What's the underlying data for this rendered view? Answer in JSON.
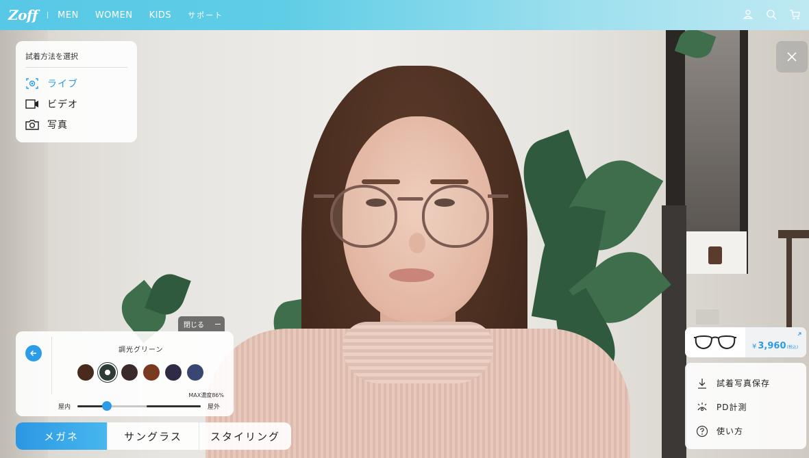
{
  "nav": {
    "logo": "Zoff",
    "links": [
      "MEN",
      "WOMEN",
      "KIDS",
      "サポート"
    ],
    "icons": [
      "user-icon",
      "search-icon",
      "cart-icon"
    ]
  },
  "mode_panel": {
    "title": "試着方法を選択",
    "items": [
      {
        "label": "ライブ",
        "icon": "live-camera-icon",
        "active": true
      },
      {
        "label": "ビデオ",
        "icon": "video-icon",
        "active": false
      },
      {
        "label": "写真",
        "icon": "photo-camera-icon",
        "active": false
      }
    ]
  },
  "color_panel": {
    "close_label": "閉じる",
    "color_name": "調光グリーン",
    "swatches": [
      "#4a2a1c",
      "#2f3b35",
      "#3a2a2a",
      "#7a3a22",
      "#2f2a45",
      "#3a4672"
    ],
    "selected_index": 1,
    "max_label": "MAX濃度86%",
    "slider_left": "屋内",
    "slider_right": "屋外",
    "slider_value": 0.24
  },
  "tabs": [
    {
      "label": "メガネ",
      "active": true
    },
    {
      "label": "サングラス",
      "active": false
    },
    {
      "label": "スタイリング",
      "active": false
    }
  ],
  "product": {
    "price": "3,960",
    "yen": "¥",
    "tax": "(税込)"
  },
  "actions": [
    {
      "label": "試着写真保存",
      "icon": "download-icon"
    },
    {
      "label": "PD計測",
      "icon": "pd-measure-icon"
    },
    {
      "label": "使い方",
      "icon": "help-icon"
    }
  ],
  "colors": {
    "accent": "#2d9ce6",
    "topbar_start": "#57c8e6"
  }
}
